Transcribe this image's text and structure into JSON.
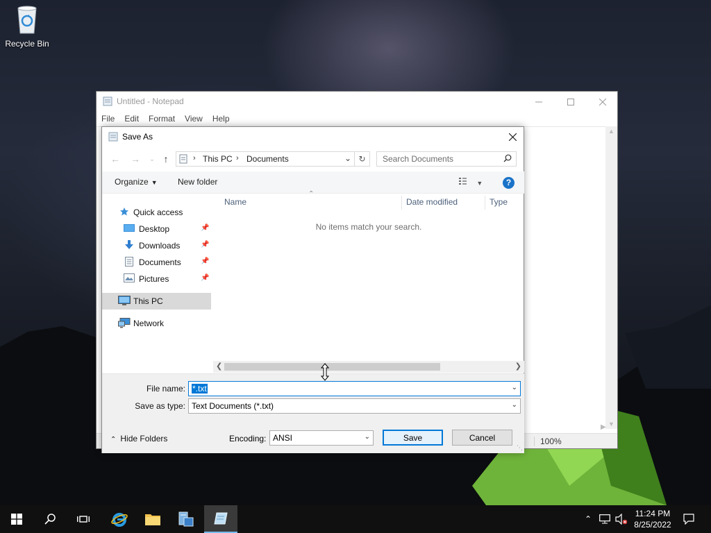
{
  "desktop": {
    "recycle_bin_label": "Recycle Bin"
  },
  "notepad": {
    "title": "Untitled - Notepad",
    "menu": [
      "File",
      "Edit",
      "Format",
      "View",
      "Help"
    ],
    "zoom": "100%"
  },
  "dialog": {
    "title": "Save As",
    "breadcrumb": [
      "This PC",
      "Documents"
    ],
    "search_placeholder": "Search Documents",
    "toolbar": {
      "organize": "Organize",
      "new_folder": "New folder"
    },
    "nav_items": [
      {
        "label": "Quick access",
        "icon": "star-icon"
      },
      {
        "label": "Desktop",
        "icon": "desktop-folder-icon",
        "pinned": true
      },
      {
        "label": "Downloads",
        "icon": "download-arrow-icon",
        "pinned": true
      },
      {
        "label": "Documents",
        "icon": "document-icon",
        "pinned": true
      },
      {
        "label": "Pictures",
        "icon": "pictures-icon",
        "pinned": true
      },
      {
        "label": "This PC",
        "icon": "computer-icon",
        "selected": true
      },
      {
        "label": "Network",
        "icon": "network-icon"
      }
    ],
    "columns": [
      "Name",
      "Date modified",
      "Type"
    ],
    "empty_message": "No items match your search.",
    "file_name_label": "File name:",
    "file_name_value": "*.txt",
    "save_type_label": "Save as type:",
    "save_type_value": "Text Documents (*.txt)",
    "hide_folders": "Hide Folders",
    "encoding_label": "Encoding:",
    "encoding_value": "ANSI",
    "save_button": "Save",
    "cancel_button": "Cancel"
  },
  "taskbar": {
    "time": "11:24 PM",
    "date": "8/25/2022"
  },
  "colors": {
    "accent": "#0078d7",
    "selection": "#d9d9d9",
    "taskbar": "#101010"
  }
}
